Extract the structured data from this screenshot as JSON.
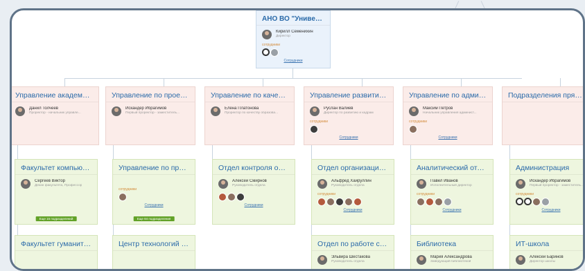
{
  "root": {
    "title": "АНО ВО \"Университет Инн...",
    "person": {
      "name": "Кирилл Семенихин",
      "role": "Директор"
    },
    "employees_label": "сотрудники",
    "link": "Сотрудники"
  },
  "departments": [
    {
      "title": "Управление академическо...",
      "person": {
        "name": "Данил Толчеев",
        "role": "Проректор - начальник управле..."
      }
    },
    {
      "title": "Управление по проектной ...",
      "person": {
        "name": "Искандер Ибрагимов",
        "role": "Первый проректор - заместитель..."
      }
    },
    {
      "title": "Управление по качеству об...",
      "person": {
        "name": "Елена Платонова",
        "role": "Проректор по качеству образова..."
      }
    },
    {
      "title": "Управление развития унив...",
      "person": {
        "name": "Руслан Валиев",
        "role": "Директор по развитию и кадрам"
      },
      "employees_label": "сотрудники",
      "link": "Сотрудники"
    },
    {
      "title": "Управление по администр...",
      "person": {
        "name": "Максим Петров",
        "role": "Начальник управления админист..."
      },
      "employees_label": "сотрудники",
      "link": "Сотрудники"
    },
    {
      "title": "Подразделения прямого п...",
      "person": {
        "name": "",
        "role": ""
      }
    }
  ],
  "subunits": [
    {
      "title": "Факультет компьютер...",
      "person": {
        "name": "Сергеев Виктор",
        "role": "Декан факультета, Профессор"
      },
      "badge": "Еще 15 подразделений"
    },
    {
      "title": "Управление по проект...",
      "person": {
        "name": "",
        "role": ""
      },
      "employees_label": "сотрудники",
      "link": "Сотрудники",
      "badge": "Еще 84 подразделения"
    },
    {
      "title": "Отдел контроля образ...",
      "person": {
        "name": "Алексей Смирнов",
        "role": "Руководитель отдела"
      },
      "link": "Сотрудники"
    },
    {
      "title": "Отдел организации ме...",
      "person": {
        "name": "Альфред Хайруллин",
        "role": "Руководитель отдела"
      },
      "employees_label": "сотрудники",
      "link": "Сотрудники"
    },
    {
      "title": "Аналитический отдел",
      "person": {
        "name": "Павел Иванов",
        "role": "Исполнительный директор"
      },
      "employees_label": "сотрудники",
      "link": "Сотрудники"
    },
    {
      "title": "Администрация",
      "person": {
        "name": "Искандер Ибрагимов",
        "role": "Первый проректор - заместитель..."
      },
      "employees_label": "сотрудники",
      "link": "Сотрудники"
    }
  ],
  "bottom": [
    {
      "title": "Факультет гуманитари..."
    },
    {
      "title": "Центр технологий ком..."
    },
    {
      "title": "Отдел по работе с пер...",
      "person": {
        "name": "Эльвира Шестакова",
        "role": "Руководитель отдела"
      }
    },
    {
      "title": "Библиотека",
      "person": {
        "name": "Мария Александрова",
        "role": "Заведующий библиотекой"
      }
    },
    {
      "title": "ИТ-школа",
      "person": {
        "name": "Алексей Баринов",
        "role": "Директор школы"
      }
    }
  ]
}
